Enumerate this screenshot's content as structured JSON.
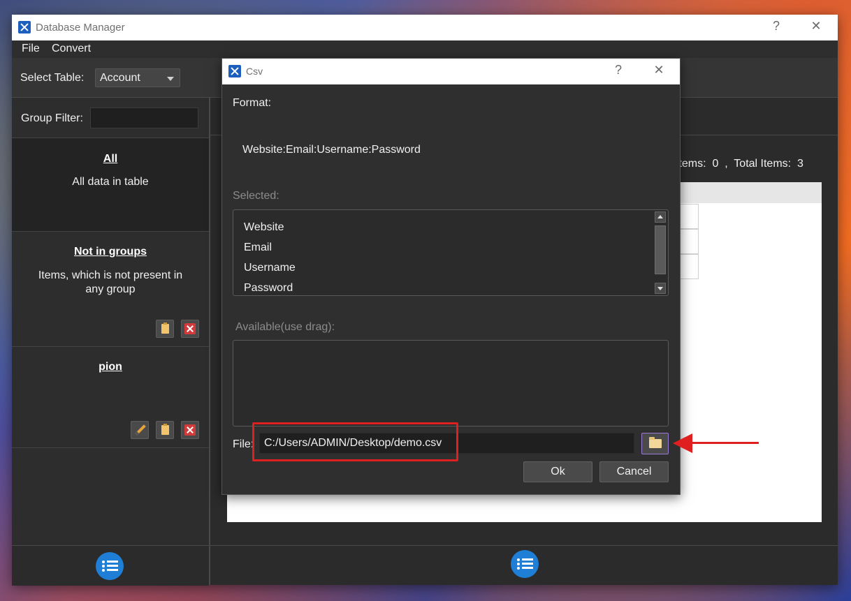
{
  "main_window": {
    "title": "Database Manager",
    "help_glyph": "?",
    "close_glyph": "✕"
  },
  "menu": {
    "file": "File",
    "convert": "Convert"
  },
  "toolbar": {
    "select_table_label": "Select Table:",
    "selected_table": "Account"
  },
  "left_panel": {
    "group_filter_label": "Group Filter:",
    "group_filter_value": "",
    "groups": [
      {
        "title": "All",
        "description": "All data in table"
      },
      {
        "title": "Not in groups",
        "description": "Items, which is not present in any group"
      },
      {
        "title": "pion",
        "description": ""
      }
    ]
  },
  "right_panel": {
    "items_text": "Items:  0  ,  Total Items:  3"
  },
  "csv_dialog": {
    "title": "Csv",
    "help_glyph": "?",
    "close_glyph": "✕",
    "format_label": "Format:",
    "format_value": "Website:Email:Username:Password",
    "selected_label": "Selected:",
    "selected_items": [
      "Website",
      "Email",
      "Username",
      "Password"
    ],
    "available_label": "Available(use drag):",
    "available_items": [],
    "file_label": "File:",
    "file_value": "C:/Users/ADMIN/Desktop/demo.csv",
    "ok_label": "Ok",
    "cancel_label": "Cancel"
  },
  "colors": {
    "accent_blue": "#1f7fd6",
    "annotation_red": "#e02020",
    "window_bg": "#2b2b2b"
  }
}
